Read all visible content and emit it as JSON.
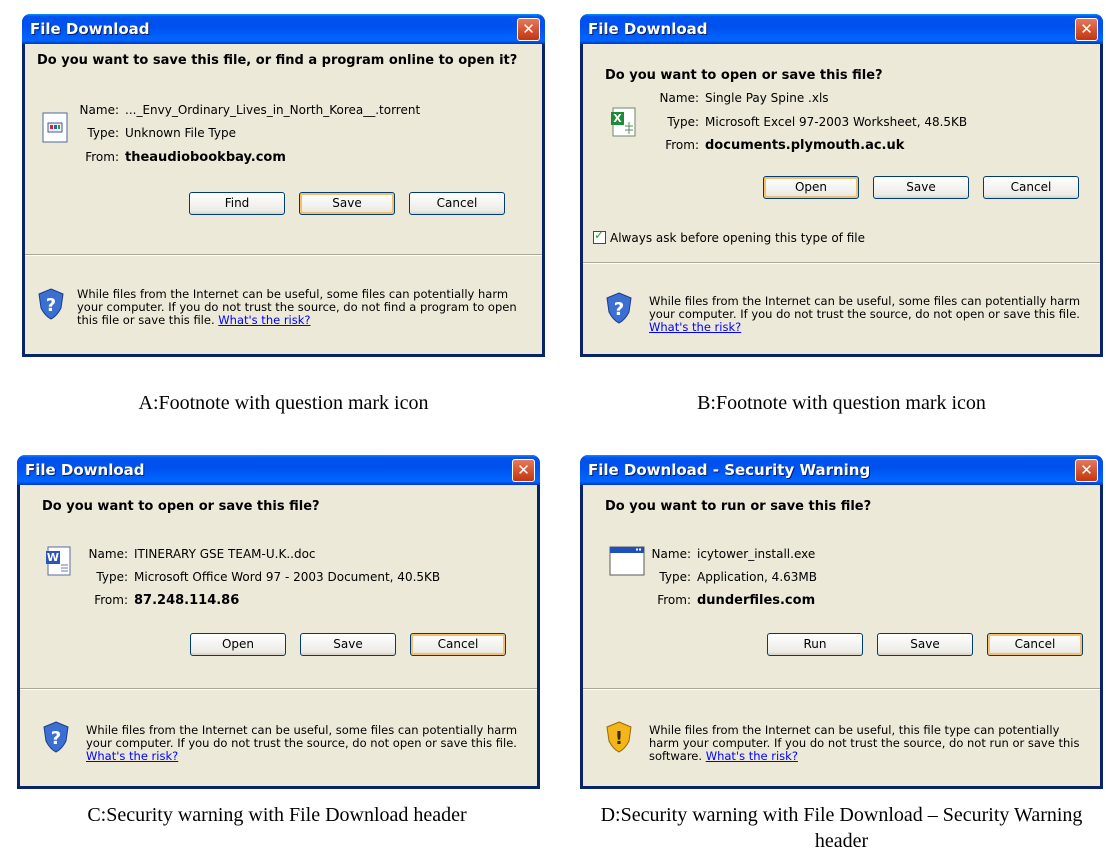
{
  "dialogs": {
    "A": {
      "title": "File Download",
      "question": "Do you want to save this file, or find a program online to open it?",
      "name_label": "Name:",
      "name_value": "..._Envy_Ordinary_Lives_in_North_Korea__.torrent",
      "type_label": "Type:",
      "type_value": "Unknown File Type",
      "from_label": "From:",
      "from_value": "theaudiobookbay.com",
      "buttons": [
        "Find",
        "Save",
        "Cancel"
      ],
      "footnote": "While files from the Internet can be useful, some files can potentially harm your computer. If you do not trust the source, do not find a program to open this file or save this file.",
      "risk_link": "What's the risk?",
      "icon": "unknown-file-icon",
      "shield": "question-shield-icon"
    },
    "B": {
      "title": "File Download",
      "question": "Do you want to open or save this file?",
      "name_label": "Name:",
      "name_value": "Single Pay Spine .xls",
      "type_label": "Type:",
      "type_value": "Microsoft Excel 97-2003 Worksheet, 48.5KB",
      "from_label": "From:",
      "from_value": "documents.plymouth.ac.uk",
      "buttons": [
        "Open",
        "Save",
        "Cancel"
      ],
      "checkbox": "Always ask before opening this type of file",
      "footnote": "While files from the Internet can be useful, some files can potentially harm your computer. If you do not trust the source, do not open or save this file.",
      "risk_link": "What's the risk?",
      "icon": "excel-file-icon",
      "shield": "question-shield-icon"
    },
    "C": {
      "title": "File Download",
      "question": "Do you want to open or save this file?",
      "name_label": "Name:",
      "name_value": "ITINERARY GSE TEAM-U.K..doc",
      "type_label": "Type:",
      "type_value": "Microsoft Office Word 97 - 2003 Document, 40.5KB",
      "from_label": "From:",
      "from_value": "87.248.114.86",
      "buttons": [
        "Open",
        "Save",
        "Cancel"
      ],
      "footnote": "While files from the Internet can be useful, some files can potentially harm your computer. If you do not trust the source, do not open or save this file.",
      "risk_link": "What's the risk?",
      "icon": "word-file-icon",
      "shield": "question-shield-icon"
    },
    "D": {
      "title": "File Download - Security Warning",
      "question": "Do you want to run or save this file?",
      "name_label": "Name:",
      "name_value": "icytower_install.exe",
      "type_label": "Type:",
      "type_value": "Application, 4.63MB",
      "from_label": "From:",
      "from_value": "dunderfiles.com",
      "buttons": [
        "Run",
        "Save",
        "Cancel"
      ],
      "footnote": "While files from the Internet can be useful, this file type can potentially harm your computer. If you do not trust the source, do not run or save this software.",
      "risk_link": "What's the risk?",
      "icon": "application-window-icon",
      "shield": "warning-shield-icon"
    }
  },
  "captions": {
    "A": "A:Footnote with question mark icon",
    "B": "B:Footnote with question mark icon",
    "C": "C:Security warning with File Download header",
    "D": "D:Security warning with File Download – Security Warning header"
  },
  "colors": {
    "titlebar": "#0054e3",
    "dialog_bg": "#ece9d8",
    "link": "#0000ff",
    "close": "#d9542b"
  }
}
